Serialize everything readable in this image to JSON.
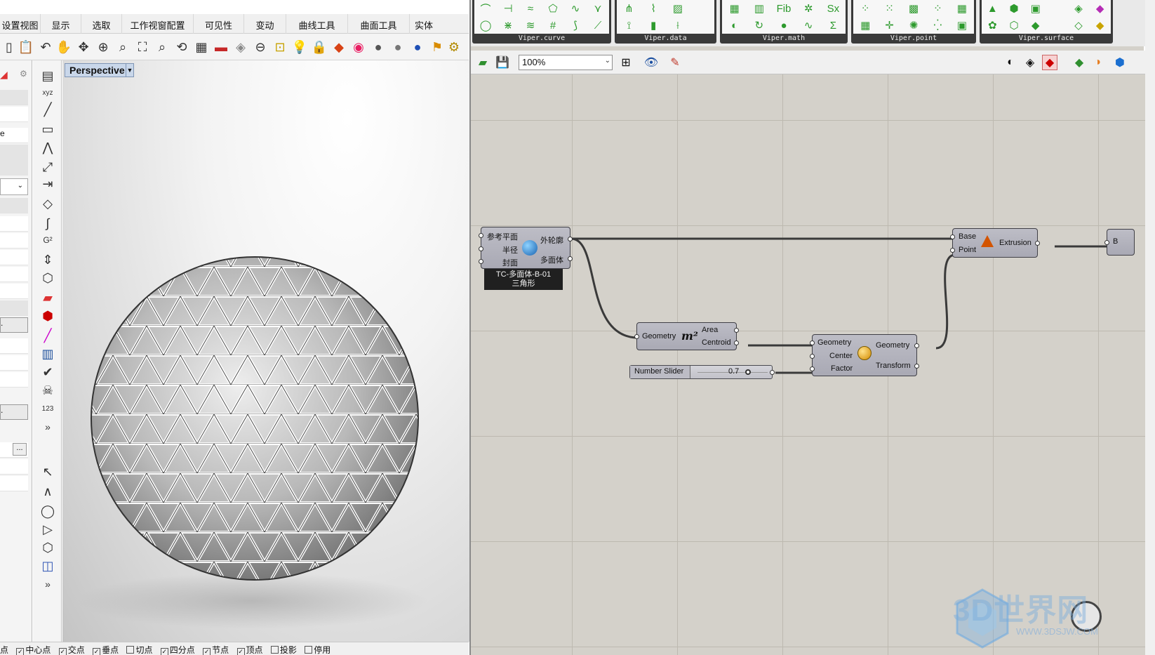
{
  "rhino": {
    "menu_tabs": [
      "设置视图",
      "显示",
      "选取",
      "工作视窗配置",
      "可见性",
      "变动",
      "曲线工具",
      "曲面工具",
      "实体"
    ],
    "viewport_title": "Perspective",
    "left_panel_buttons": [
      ".",
      ".",
      "..."
    ],
    "vertical_toolbar_counter": "123",
    "more_tools": "»",
    "osnaps": [
      {
        "label": "点",
        "checked": true
      },
      {
        "label": "中心点",
        "checked": true
      },
      {
        "label": "交点",
        "checked": true
      },
      {
        "label": "垂点",
        "checked": true
      },
      {
        "label": "切点",
        "checked": false
      },
      {
        "label": "四分点",
        "checked": true
      },
      {
        "label": "节点",
        "checked": true
      },
      {
        "label": "顶点",
        "checked": true
      },
      {
        "label": "投影",
        "checked": false
      },
      {
        "label": "停用",
        "checked": false
      }
    ]
  },
  "grasshopper": {
    "ribbon_groups": [
      "Viper.curve",
      "Viper.data",
      "Viper.math",
      "Viper.point",
      "Viper.surface"
    ],
    "zoom_value": "100%",
    "components": {
      "cluster": {
        "inputs": [
          "参考平面",
          "半径",
          "封面"
        ],
        "outputs": [
          "外轮廓",
          "多面体"
        ],
        "name_line1": "TC-多面体-B-01",
        "name_line2": "三角形"
      },
      "area": {
        "input": "Geometry",
        "icon_text": "m²",
        "outputs": [
          "Area",
          "Centroid"
        ]
      },
      "slider": {
        "label": "Number Slider",
        "value": "0.7"
      },
      "scale": {
        "inputs": [
          "Geometry",
          "Center",
          "Factor"
        ],
        "outputs": [
          "Geometry",
          "Transform"
        ]
      },
      "extrude": {
        "inputs": [
          "Base",
          "Point"
        ],
        "output": "Extrusion"
      },
      "partial_next": "B"
    }
  },
  "watermark": {
    "main": "3D世界网",
    "sub": "WWW.3DSJW.COM"
  }
}
